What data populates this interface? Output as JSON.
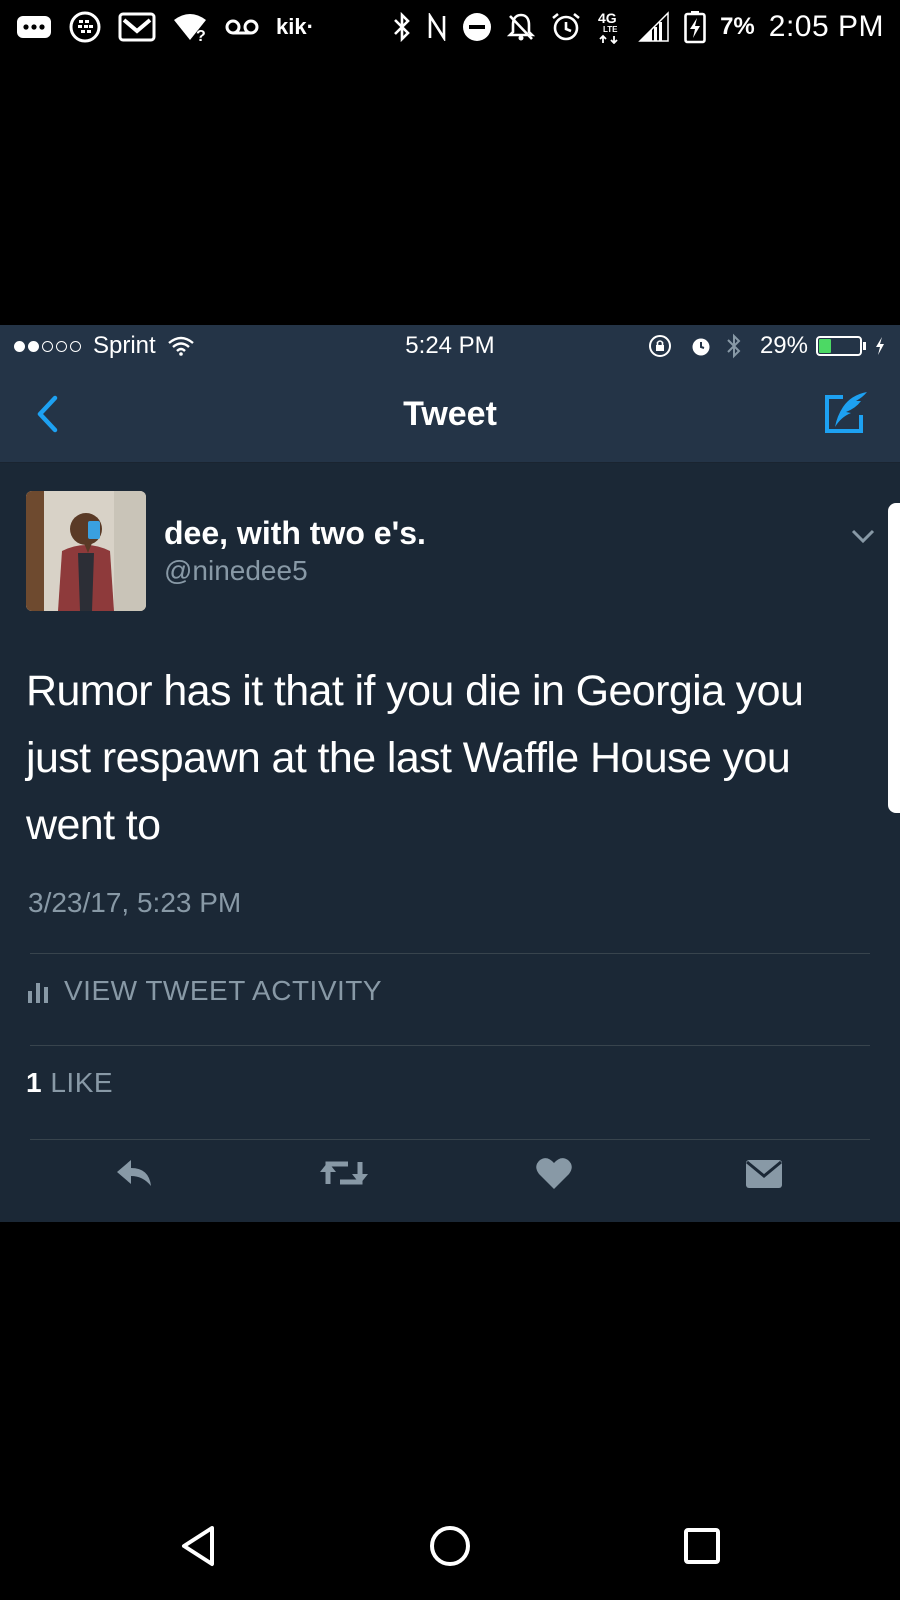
{
  "android_status": {
    "battery_pct": "7%",
    "time": "2:05 PM",
    "network": "4G",
    "network_sub": "LTE",
    "kik_label": "kik·",
    "wifi_unknown": "?"
  },
  "ios_status": {
    "carrier": "Sprint",
    "signal_dots_filled": 2,
    "signal_dots_total": 5,
    "time": "5:24 PM",
    "battery_pct": "29%",
    "battery_level": 0.29
  },
  "nav": {
    "title": "Tweet"
  },
  "tweet": {
    "display_name": "dee, with two e's.",
    "handle": "@ninedee5",
    "text": "Rumor has it that if you die in Georgia you just respawn at the last Waffle House you went to",
    "timestamp": "3/23/17, 5:23 PM",
    "activity_label": "VIEW TWEET ACTIVITY",
    "likes_count": "1",
    "likes_label": "LIKE"
  },
  "icons": {
    "back": "chevron-left-icon",
    "compose": "compose-tweet-icon",
    "more": "chevron-down-icon",
    "activity": "bar-chart-icon",
    "reply": "reply-icon",
    "retweet": "retweet-icon",
    "like": "heart-icon",
    "dm": "envelope-icon"
  },
  "colors": {
    "background": "#1b2836",
    "bar": "#243447",
    "accent": "#1da1f2",
    "muted": "#8899a6",
    "battery_green": "#4cd964"
  }
}
